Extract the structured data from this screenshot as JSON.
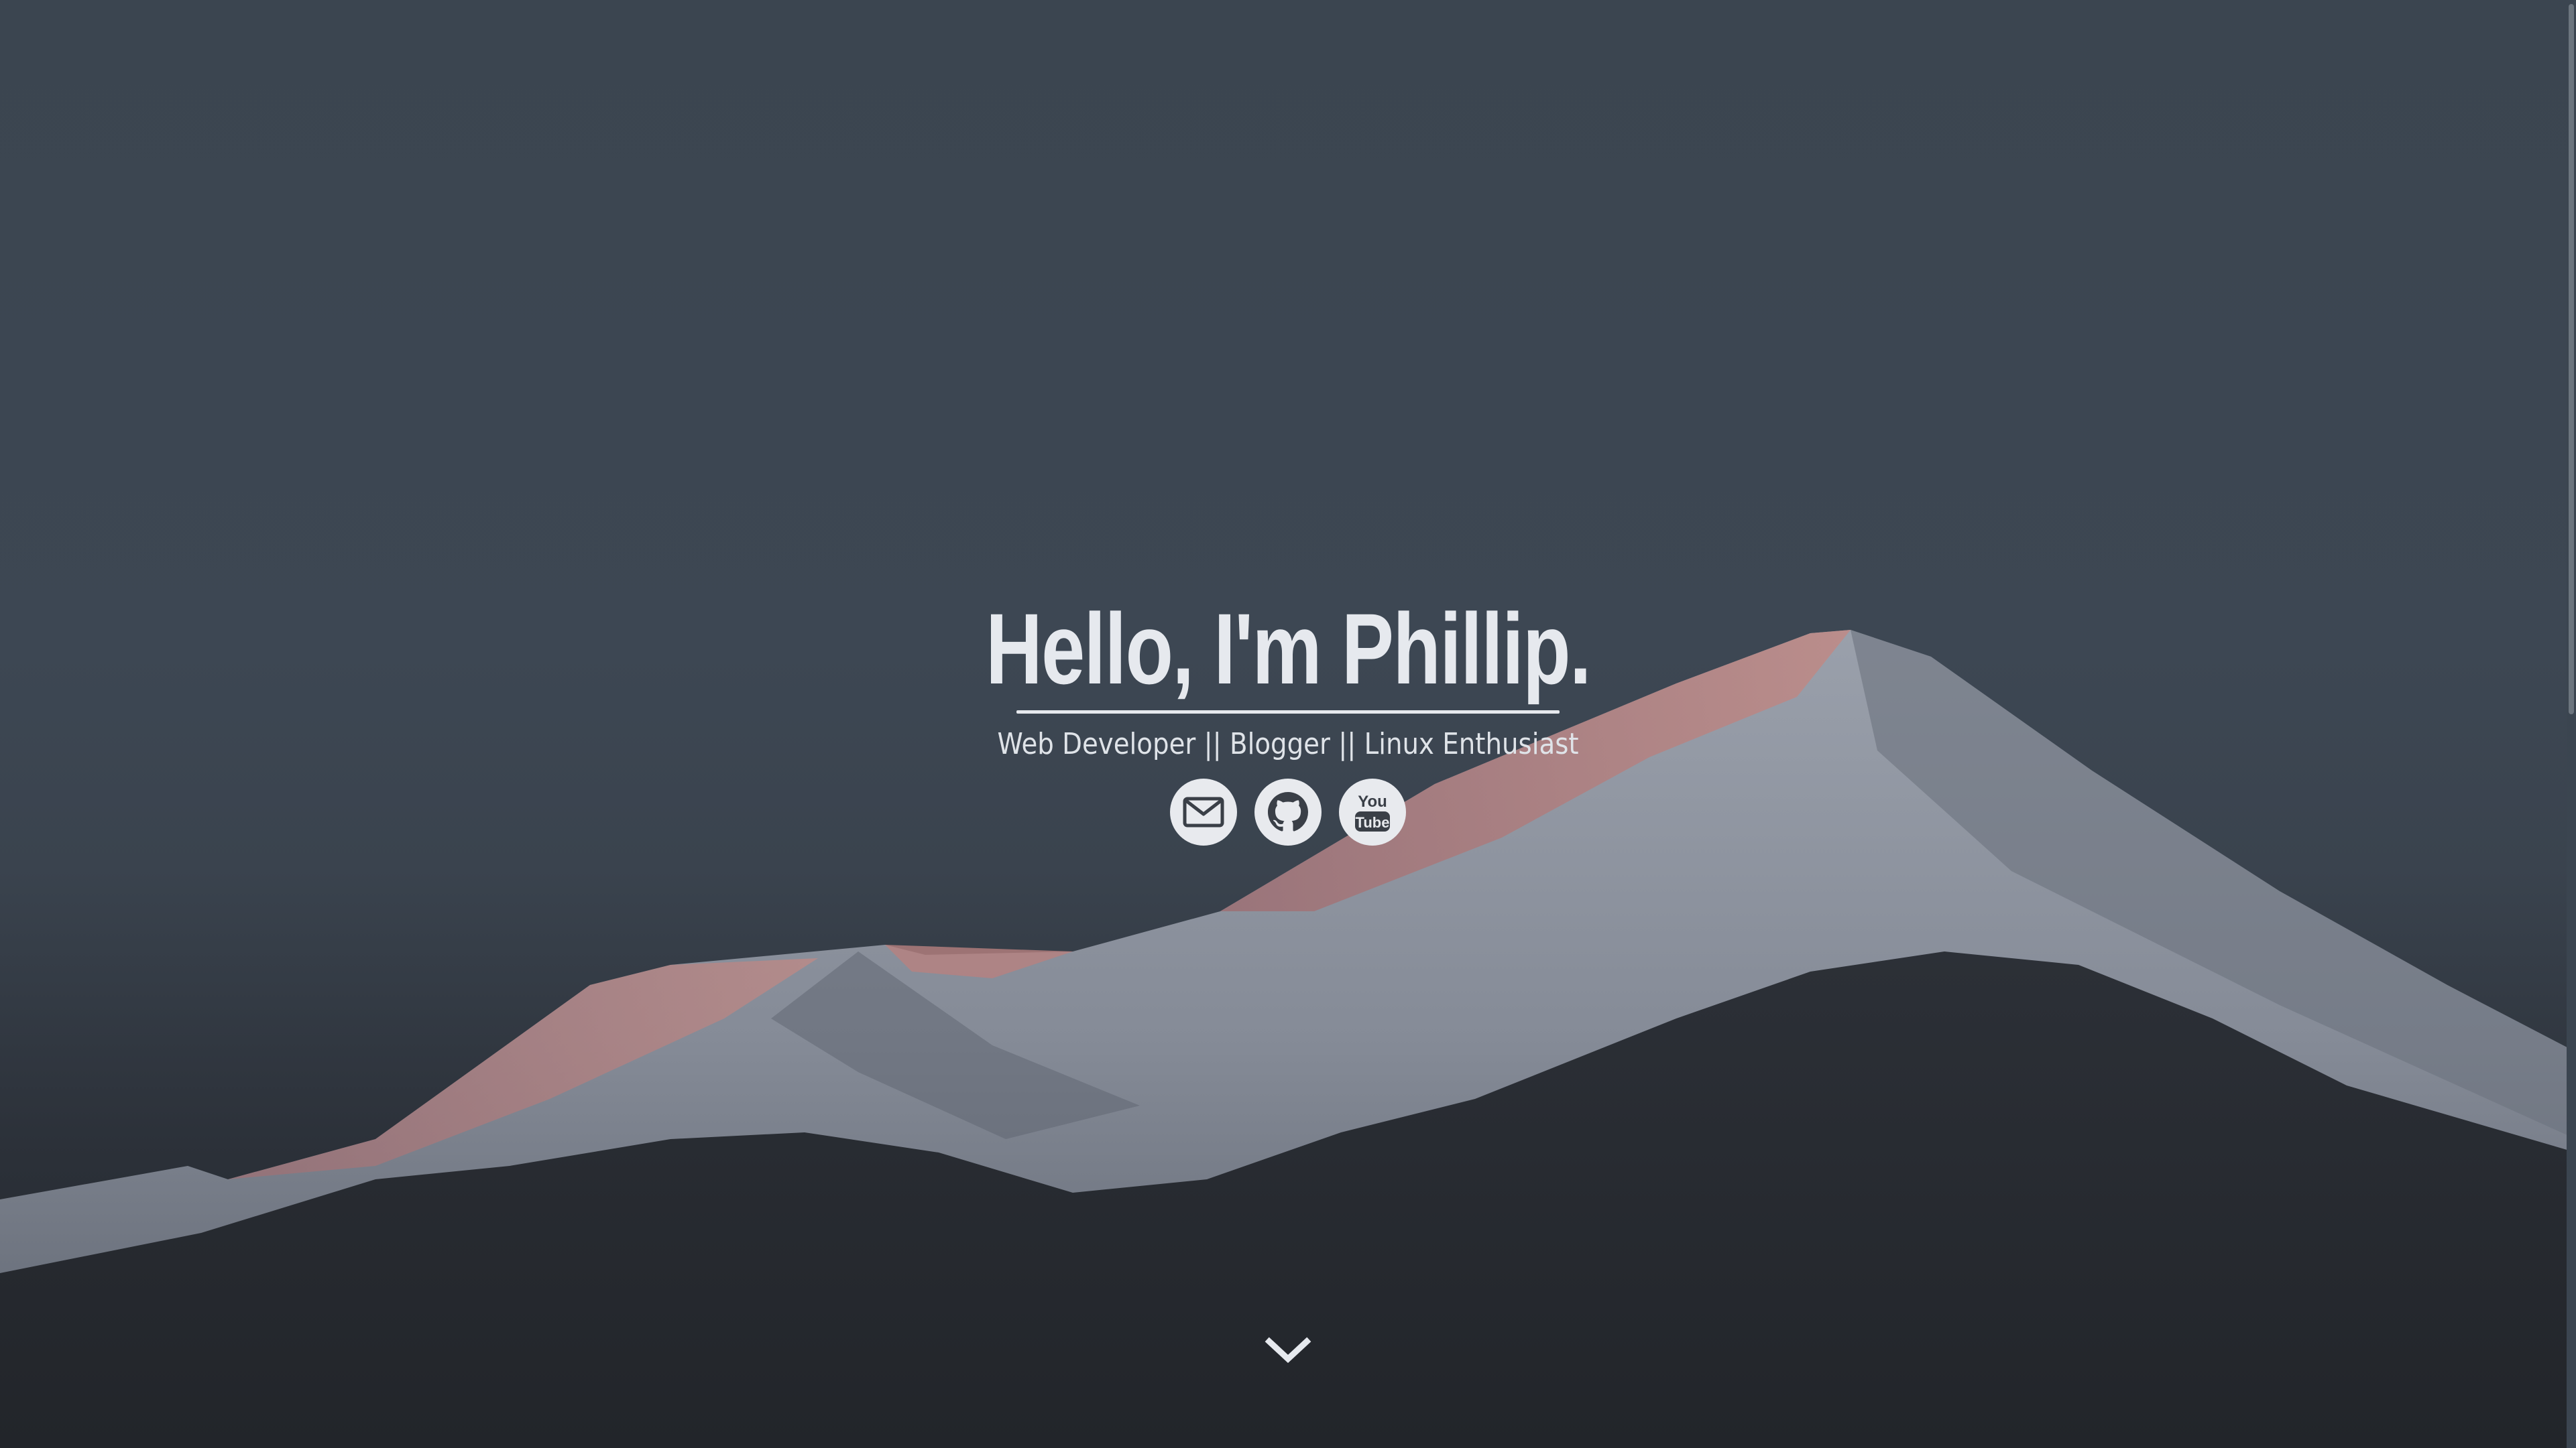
{
  "hero": {
    "title": "Hello, I'm Phillip.",
    "subtitle": "Web Developer || Blogger || Linux Enthusiast"
  },
  "social": [
    {
      "name": "email",
      "icon": "mail-icon"
    },
    {
      "name": "github",
      "icon": "github-icon"
    },
    {
      "name": "youtube",
      "icon": "youtube-icon",
      "label_top": "You",
      "label_bottom": "Tube"
    }
  ],
  "scroll_indicator": {
    "icon": "chevron-down-icon"
  },
  "colors": {
    "sky": "#3b4550",
    "foreground_dark": "#24272d",
    "text": "#e6e9ee",
    "icon_bg": "#e8eaee",
    "icon_fg": "#3a3f47",
    "alpenglow": "#b0777a"
  }
}
